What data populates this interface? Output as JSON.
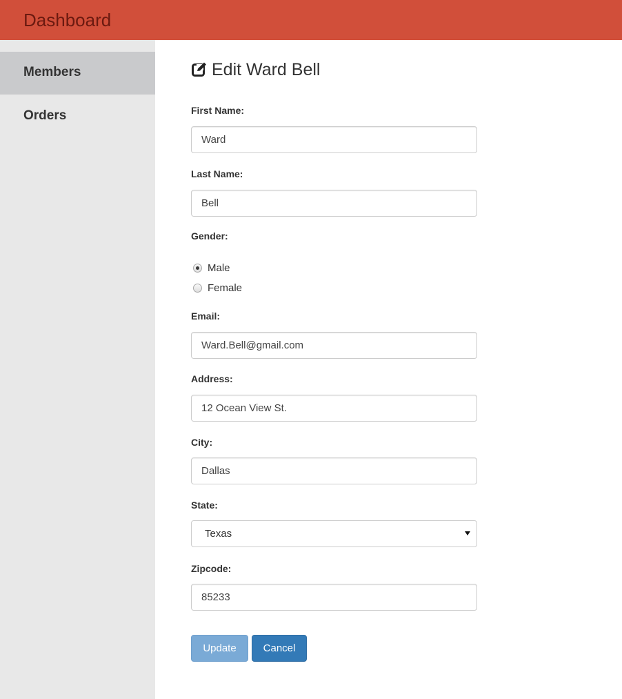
{
  "header": {
    "brand": "Dashboard"
  },
  "sidebar": {
    "items": [
      {
        "label": "Members",
        "active": true
      },
      {
        "label": "Orders",
        "active": false
      }
    ]
  },
  "main": {
    "title": "Edit Ward Bell",
    "title_icon": "edit-icon",
    "form": {
      "first_name": {
        "label": "First Name:",
        "value": "Ward"
      },
      "last_name": {
        "label": "Last Name:",
        "value": "Bell"
      },
      "gender": {
        "label": "Gender:",
        "options": [
          {
            "label": "Male",
            "checked": true
          },
          {
            "label": "Female",
            "checked": false
          }
        ]
      },
      "email": {
        "label": "Email:",
        "value": "Ward.Bell@gmail.com"
      },
      "address": {
        "label": "Address:",
        "value": "12 Ocean View St."
      },
      "city": {
        "label": "City:",
        "value": "Dallas"
      },
      "state": {
        "label": "State:",
        "value": "Texas"
      },
      "zipcode": {
        "label": "Zipcode:",
        "value": "85233"
      }
    },
    "buttons": {
      "update": "Update",
      "cancel": "Cancel"
    }
  },
  "colors": {
    "header_bg": "#d14f3a",
    "brand_text": "#6b1a10",
    "sidebar_bg": "#e8e8e8",
    "sidebar_active_bg": "#c9cacc",
    "primary": "#337ab7",
    "primary_disabled": "#7aaad6"
  }
}
